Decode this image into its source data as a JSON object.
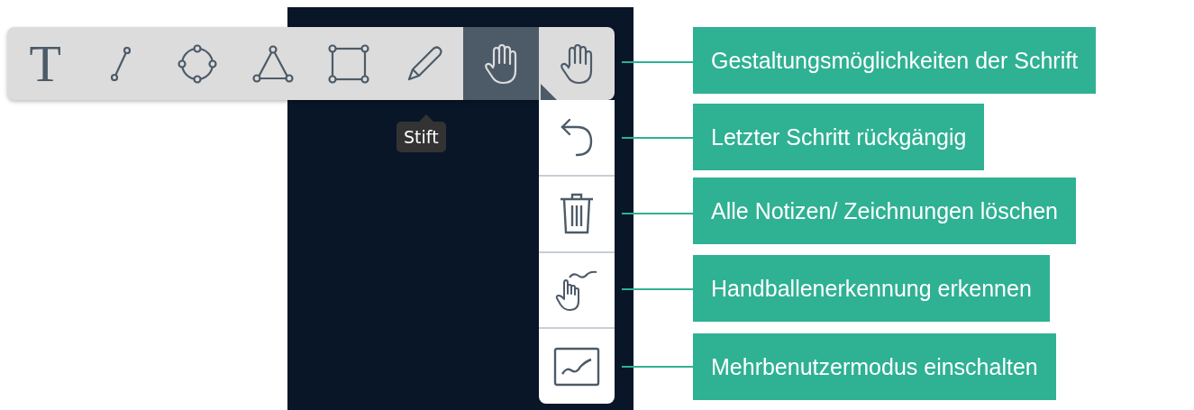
{
  "toolbar": {
    "tools": [
      {
        "kind": "text",
        "label": "T",
        "selected": false,
        "submenu": false
      },
      {
        "kind": "line",
        "selected": false,
        "submenu": false
      },
      {
        "kind": "circle",
        "selected": false,
        "submenu": false
      },
      {
        "kind": "triangle",
        "selected": false,
        "submenu": false
      },
      {
        "kind": "rectangle",
        "selected": false,
        "submenu": false
      },
      {
        "kind": "pencil",
        "selected": false,
        "submenu": false
      },
      {
        "kind": "hand",
        "selected": true,
        "submenu": false
      },
      {
        "kind": "hand",
        "selected": false,
        "submenu": true
      }
    ],
    "tooltip": "Stift"
  },
  "side_menu": {
    "items": [
      {
        "kind": "undo"
      },
      {
        "kind": "trash"
      },
      {
        "kind": "palm"
      },
      {
        "kind": "chart"
      }
    ]
  },
  "callouts": [
    "Gestaltungsmöglichkeiten der Schrift",
    "Letzter Schritt rückgängig",
    "Alle Notizen/ Zeichnungen löschen",
    "Handballenerkennung erkennen",
    "Mehrbenutzermodus einschalten"
  ]
}
